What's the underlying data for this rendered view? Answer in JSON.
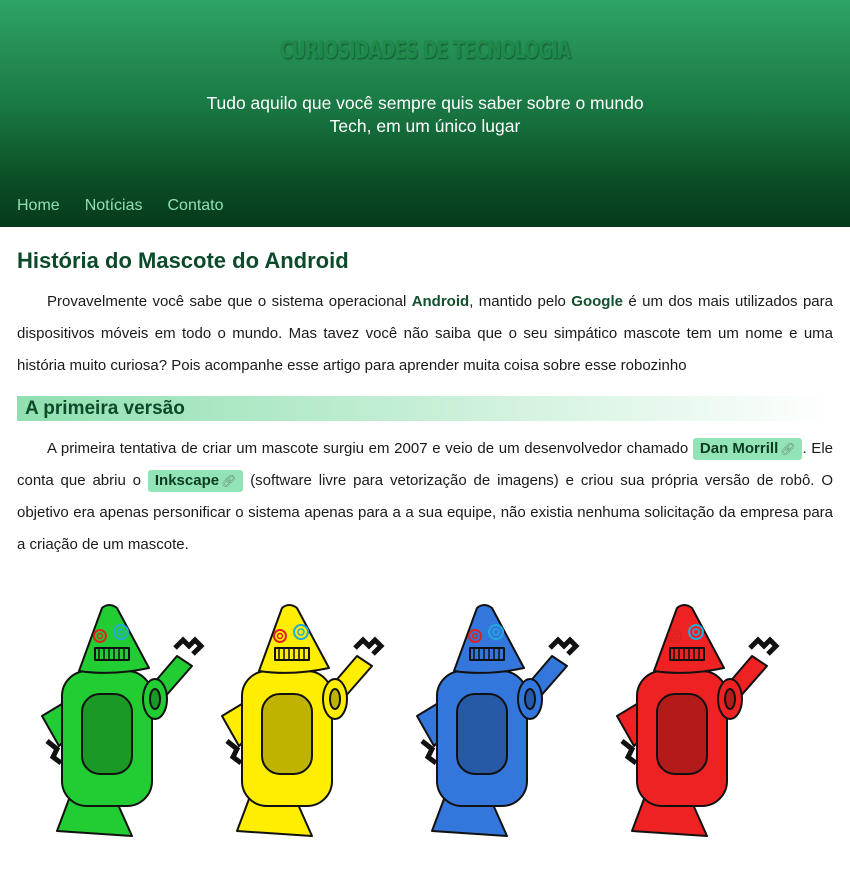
{
  "header": {
    "title": "CURIOSIDADES DE TECNOLOGIA",
    "subtitle_line1": "Tudo aquilo que você sempre quis saber sobre o mundo",
    "subtitle_line2": "Tech, em um único lugar"
  },
  "nav": {
    "items": [
      {
        "label": "Home"
      },
      {
        "label": "Notícias"
      },
      {
        "label": "Contato"
      }
    ]
  },
  "article": {
    "title": "História do Mascote do Android",
    "intro": {
      "t1": "Provavelmente você sabe que o sistema operacional ",
      "android": "Android",
      "t2": ", mantido pelo ",
      "google": "Google",
      "t3": " é um dos mais utilizados para dispositivos móveis em todo o mundo. Mas tavez você não saiba que o seu simpático mascote tem um nome e uma história muito curiosa? Pois acompanhe esse artigo para aprender muita coisa sobre esse robozinho"
    },
    "section1": {
      "heading": "A primeira versão",
      "t1": "A primeira tentativa de criar um mascote surgiu em 2007 e veio de um desenvolvedor chamado ",
      "link1": "Dan Morrill",
      "t2": ". Ele conta que abriu o ",
      "link2": "Inkscape",
      "t3": " (software livre para vetorização de imagens) e criou sua própria versão de robô. O objetivo era apenas personificar o sistema apenas para a a sua equipe, não existia nenhuma solicitação da empresa para a criação de um mascote."
    }
  },
  "mascots": {
    "colors": [
      "#22cc33",
      "#ffee00",
      "#3377dd",
      "#ee2222"
    ],
    "names": [
      "green-robot",
      "yellow-robot",
      "blue-robot",
      "red-robot"
    ]
  }
}
